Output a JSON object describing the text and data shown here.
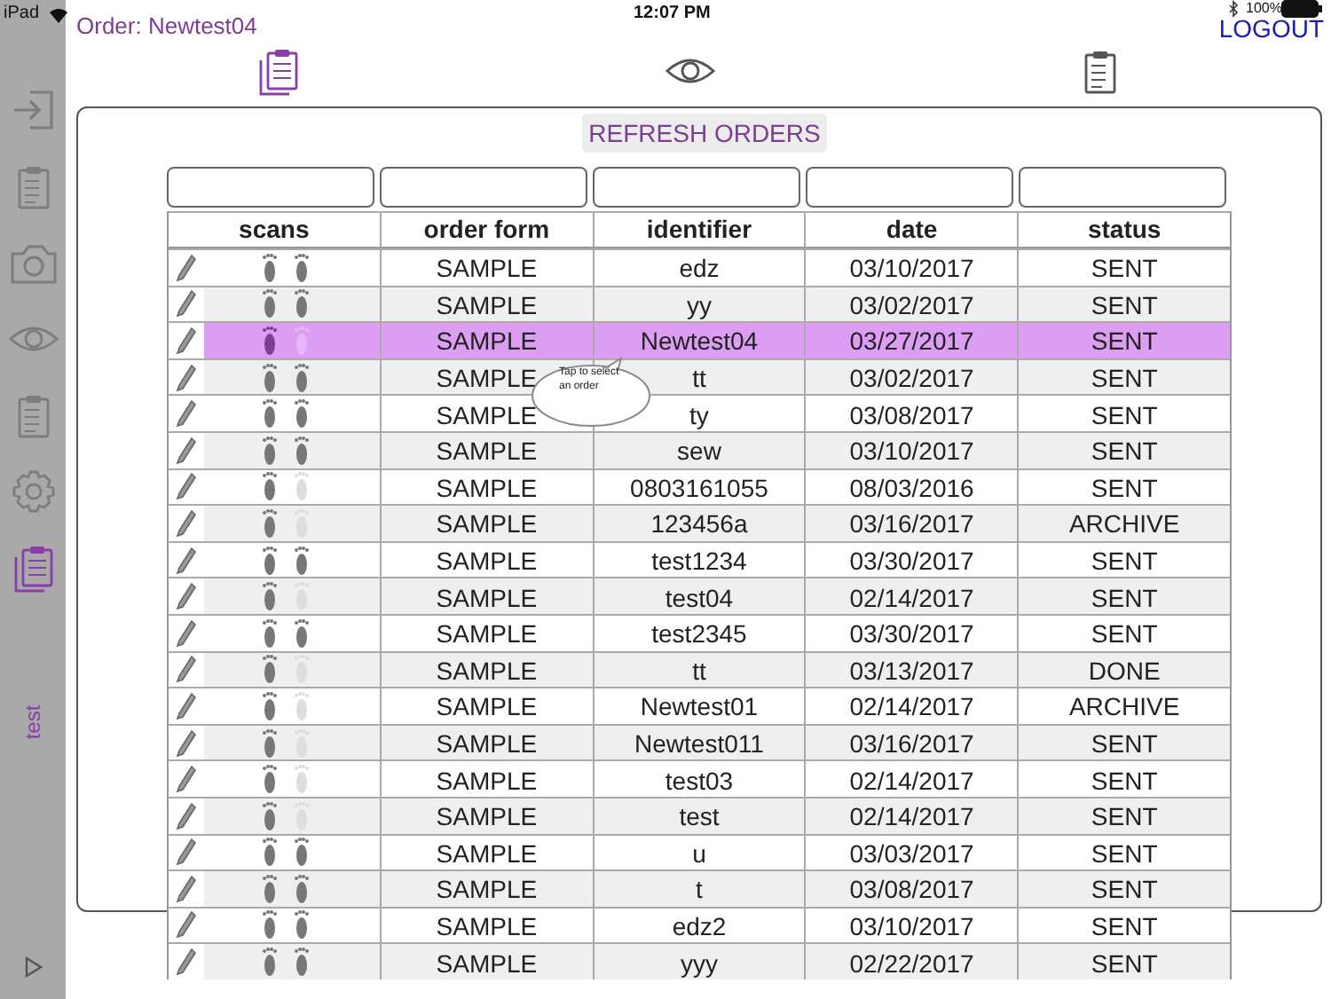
{
  "status_bar": {
    "device": "iPad",
    "time": "12:07 PM",
    "battery": "100%"
  },
  "order_title": "Order: Newtest04",
  "logout": "LOGOUT",
  "toolbar": [
    {
      "kind": "stack",
      "selected": true
    },
    {
      "kind": "eye",
      "selected": false
    },
    {
      "kind": "clipboard",
      "selected": false
    }
  ],
  "sidebar": {
    "items": [
      {
        "kind": "signin",
        "selected": false
      },
      {
        "kind": "clipboard",
        "selected": false
      },
      {
        "kind": "camera",
        "selected": false
      },
      {
        "kind": "eye",
        "selected": false
      },
      {
        "kind": "clipboard",
        "selected": false
      },
      {
        "kind": "gear",
        "selected": false
      },
      {
        "kind": "stack",
        "selected": true
      }
    ],
    "user": "test"
  },
  "refresh_button": "REFRESH ORDERS",
  "table": {
    "columns": [
      "scans",
      "order form",
      "identifier",
      "date",
      "status"
    ],
    "rows": [
      {
        "order_form": "SAMPLE",
        "identifier": "edz",
        "date": "03/10/2017",
        "status": "SENT",
        "right_scan": true,
        "selected": false
      },
      {
        "order_form": "SAMPLE",
        "identifier": "yy",
        "date": "03/02/2017",
        "status": "SENT",
        "right_scan": true,
        "selected": false
      },
      {
        "order_form": "SAMPLE",
        "identifier": "Newtest04",
        "date": "03/27/2017",
        "status": "SENT",
        "right_scan": false,
        "selected": true
      },
      {
        "order_form": "SAMPLE",
        "identifier": "tt",
        "date": "03/02/2017",
        "status": "SENT",
        "right_scan": true,
        "selected": false
      },
      {
        "order_form": "SAMPLE",
        "identifier": "ty",
        "date": "03/08/2017",
        "status": "SENT",
        "right_scan": true,
        "selected": false
      },
      {
        "order_form": "SAMPLE",
        "identifier": "sew",
        "date": "03/10/2017",
        "status": "SENT",
        "right_scan": true,
        "selected": false
      },
      {
        "order_form": "SAMPLE",
        "identifier": "0803161055",
        "date": "08/03/2016",
        "status": "SENT",
        "right_scan": false,
        "selected": false
      },
      {
        "order_form": "SAMPLE",
        "identifier": "123456a",
        "date": "03/16/2017",
        "status": "ARCHIVE",
        "right_scan": false,
        "selected": false
      },
      {
        "order_form": "SAMPLE",
        "identifier": "test1234",
        "date": "03/30/2017",
        "status": "SENT",
        "right_scan": true,
        "selected": false
      },
      {
        "order_form": "SAMPLE",
        "identifier": "test04",
        "date": "02/14/2017",
        "status": "SENT",
        "right_scan": false,
        "selected": false
      },
      {
        "order_form": "SAMPLE",
        "identifier": "test2345",
        "date": "03/30/2017",
        "status": "SENT",
        "right_scan": true,
        "selected": false
      },
      {
        "order_form": "SAMPLE",
        "identifier": "tt",
        "date": "03/13/2017",
        "status": "DONE",
        "right_scan": false,
        "selected": false
      },
      {
        "order_form": "SAMPLE",
        "identifier": "Newtest01",
        "date": "02/14/2017",
        "status": "ARCHIVE",
        "right_scan": false,
        "selected": false
      },
      {
        "order_form": "SAMPLE",
        "identifier": "Newtest011",
        "date": "03/16/2017",
        "status": "SENT",
        "right_scan": false,
        "selected": false
      },
      {
        "order_form": "SAMPLE",
        "identifier": "test03",
        "date": "02/14/2017",
        "status": "SENT",
        "right_scan": false,
        "selected": false
      },
      {
        "order_form": "SAMPLE",
        "identifier": "test",
        "date": "02/14/2017",
        "status": "SENT",
        "right_scan": false,
        "selected": false
      },
      {
        "order_form": "SAMPLE",
        "identifier": "u",
        "date": "03/03/2017",
        "status": "SENT",
        "right_scan": true,
        "selected": false
      },
      {
        "order_form": "SAMPLE",
        "identifier": "t",
        "date": "03/08/2017",
        "status": "SENT",
        "right_scan": true,
        "selected": false
      },
      {
        "order_form": "SAMPLE",
        "identifier": "edz2",
        "date": "03/10/2017",
        "status": "SENT",
        "right_scan": true,
        "selected": false
      },
      {
        "order_form": "SAMPLE",
        "identifier": "yyy",
        "date": "02/22/2017",
        "status": "SENT",
        "right_scan": true,
        "selected": false
      }
    ]
  },
  "tooltip": "Tap to select an order"
}
